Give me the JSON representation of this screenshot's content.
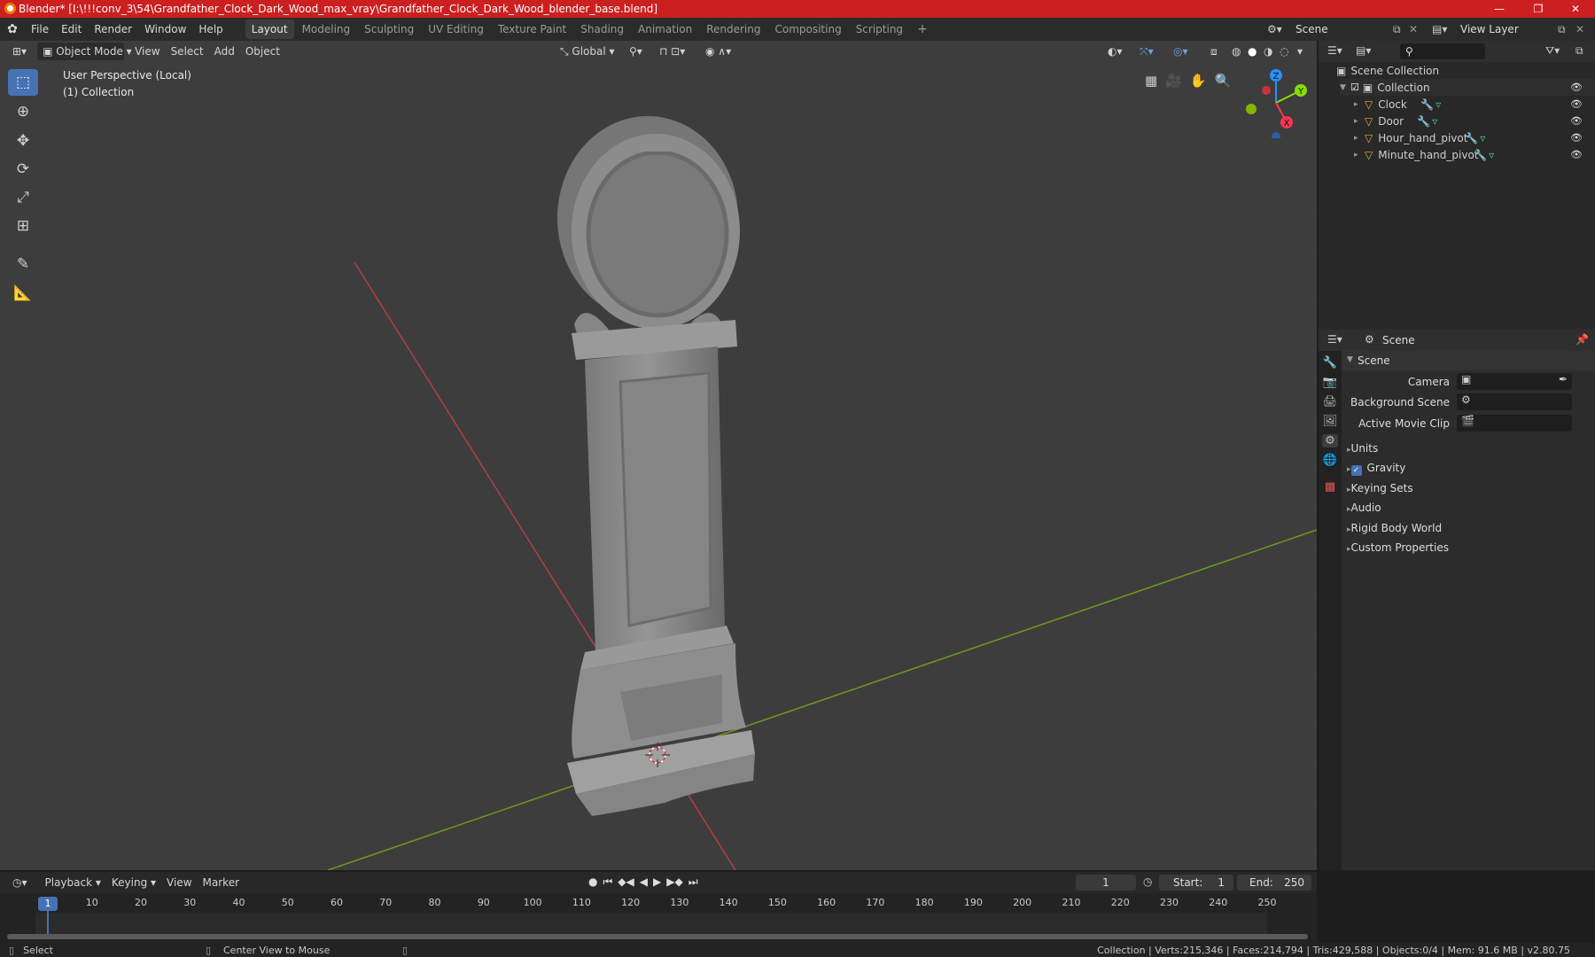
{
  "window": {
    "title": "Blender* [I:\\!!!conv_3\\54\\Grandfather_Clock_Dark_Wood_max_vray\\Grandfather_Clock_Dark_Wood_blender_base.blend]",
    "minimize": "—",
    "maximize": "❐",
    "close": "✕"
  },
  "menu": [
    "File",
    "Edit",
    "Render",
    "Window",
    "Help"
  ],
  "workspaces": [
    "Layout",
    "Modeling",
    "Sculpting",
    "UV Editing",
    "Texture Paint",
    "Shading",
    "Animation",
    "Rendering",
    "Compositing",
    "Scripting"
  ],
  "workspace_add": "+",
  "scene_field": "Scene",
  "view_layer_field": "View Layer",
  "viewport": {
    "mode": "Object Mode",
    "menus": [
      "View",
      "Select",
      "Add",
      "Object"
    ],
    "orientation": "Global",
    "overlay_line1": "User Perspective (Local)",
    "overlay_line2": "(1) Collection",
    "gizmo": {
      "z": "Z",
      "y": "Y",
      "x": "X"
    }
  },
  "outliner": {
    "root": "Scene Collection",
    "collection": "Collection",
    "items": [
      "Clock",
      "Door",
      "Hour_hand_pivot",
      "Minute_hand_pivot"
    ]
  },
  "properties": {
    "header": "Scene",
    "section": "Scene",
    "fields": [
      {
        "label": "Camera"
      },
      {
        "label": "Background Scene"
      },
      {
        "label": "Active Movie Clip"
      }
    ],
    "panels": [
      "Units",
      "Gravity",
      "Keying Sets",
      "Audio",
      "Rigid Body World",
      "Custom Properties"
    ]
  },
  "timeline": {
    "menus": [
      "Playback",
      "Keying",
      "View",
      "Marker"
    ],
    "current_frame": "1",
    "start_label": "Start:",
    "start": "1",
    "end_label": "End:",
    "end": "250",
    "ticks": [
      "1",
      "10",
      "20",
      "30",
      "40",
      "50",
      "60",
      "70",
      "80",
      "90",
      "100",
      "110",
      "120",
      "130",
      "140",
      "150",
      "160",
      "170",
      "180",
      "190",
      "200",
      "210",
      "220",
      "230",
      "240",
      "250"
    ]
  },
  "status": {
    "left": "Select",
    "middle": "Center View to Mouse",
    "right": "Collection | Verts:215,346 | Faces:214,794 | Tris:429,588 | Objects:0/4 | Mem: 91.6 MB | v2.80.75"
  },
  "colors": {
    "accent": "#4772b3",
    "titlebar": "#cc1f1f",
    "axis_x": "#ff3352",
    "axis_y": "#8bdc00",
    "axis_z": "#2890ff"
  }
}
